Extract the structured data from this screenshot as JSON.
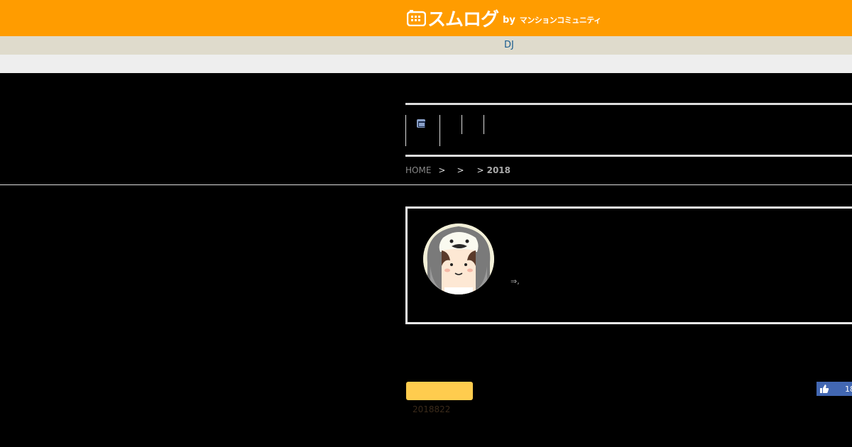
{
  "header": {
    "logo_text": "スムログ",
    "logo_by": "by",
    "logo_sub": "マンションコミュニティ",
    "brand_color": "#ff9c00"
  },
  "subbar": {
    "link_label": "DJ"
  },
  "breadcrumb": {
    "home": "HOME",
    "sep": ">",
    "current": "2018"
  },
  "profile": {
    "text": "⇒,"
  },
  "post": {
    "date": "2018822",
    "category_color": "#ffcc4e"
  },
  "social": {
    "like_count": "18",
    "like_color": "#4267b2"
  }
}
